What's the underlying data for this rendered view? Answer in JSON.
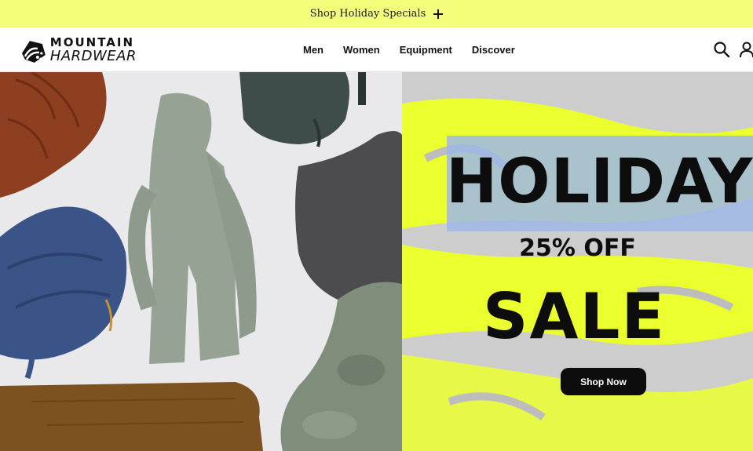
{
  "promo": {
    "text": "Shop Holiday Specials",
    "icon": "plus-icon"
  },
  "header": {
    "logo": {
      "line1": "MOUNTAIN",
      "line2": "HARDWEAR"
    },
    "nav": [
      "Men",
      "Women",
      "Equipment",
      "Discover"
    ],
    "icons": [
      "search-icon",
      "account-icon"
    ]
  },
  "hero": {
    "headline_top": "HOLIDAY",
    "headline_mid": "25% OFF",
    "headline_bottom": "SALE",
    "cta": "Shop Now"
  },
  "colors": {
    "promo_bg": "#f3ff7a",
    "accent_yellow": "#ecff2e",
    "accent_blue": "#9fb7e6",
    "button_bg": "#0d0d0d"
  }
}
